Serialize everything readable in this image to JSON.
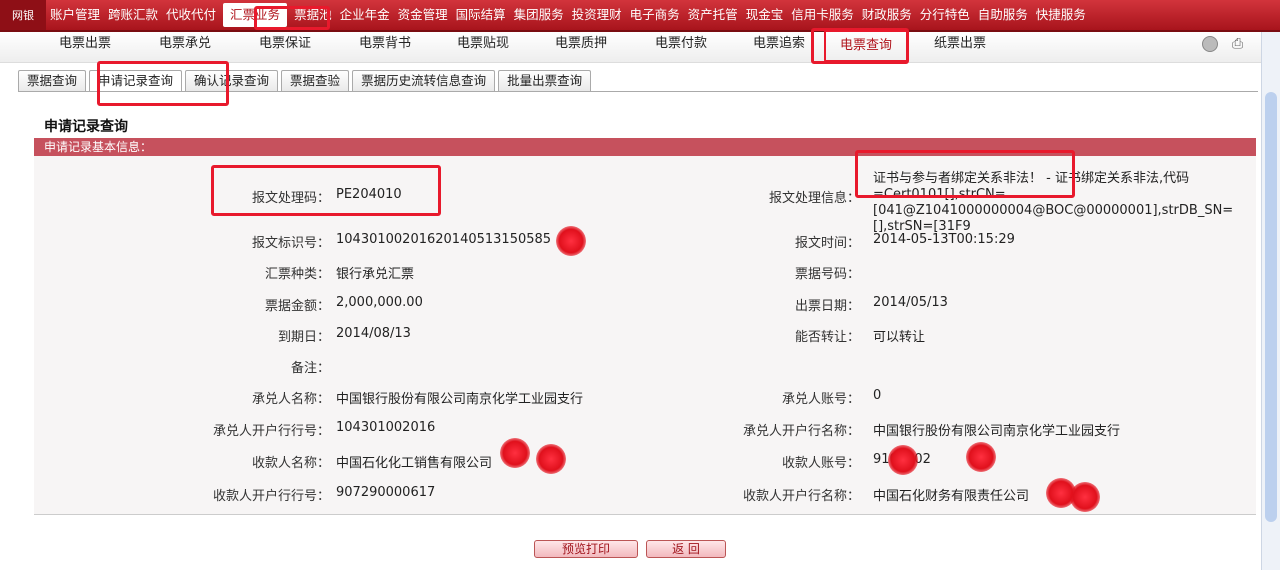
{
  "logo": {
    "text": "网银"
  },
  "top_nav": {
    "items": [
      "账户管理",
      "跨账汇款",
      "代收代付",
      "汇票业务",
      "票据池",
      "企业年金",
      "资金管理",
      "国际结算",
      "集团服务",
      "投资理财",
      "电子商务",
      "资产托管",
      "现金宝",
      "信用卡服务",
      "财政服务",
      "分行特色",
      "自助服务",
      "快捷服务"
    ],
    "active_index": 3
  },
  "sub_nav": {
    "items": [
      "电票出票",
      "电票承兑",
      "电票保证",
      "电票背书",
      "电票贴现",
      "电票质押",
      "电票付款",
      "电票追索",
      "电票查询",
      "纸票出票"
    ],
    "active_index": 8
  },
  "tabs": {
    "items": [
      "票据查询",
      "申请记录查询",
      "确认记录查询",
      "票据查验",
      "票据历史流转信息查询",
      "批量出票查询"
    ],
    "active_index": 1
  },
  "section": {
    "title": "申请记录查询",
    "bar": "申请记录基本信息："
  },
  "fields": {
    "proc_code": {
      "label": "报文处理码：",
      "value": "PE204010"
    },
    "proc_msg": {
      "label": "报文处理信息：",
      "value": "证书与参与者绑定关系非法！ - 证书绑定关系非法,代码=Cert0101[],strCN=[041@Z1041000000004@BOC@00000001],strDB_SN=[],strSN=[31F9"
    },
    "msg_id": {
      "label": "报文标识号：",
      "value": "10430100201620140513150585"
    },
    "msg_time": {
      "label": "报文时间：",
      "value": "2014-05-13T00:15:29"
    },
    "bill_type": {
      "label": "汇票种类：",
      "value": "银行承兑汇票"
    },
    "bill_no": {
      "label": "票据号码：",
      "value": ""
    },
    "amount": {
      "label": "票据金额：",
      "value": "2,000,000.00"
    },
    "issue_date": {
      "label": "出票日期：",
      "value": "2014/05/13"
    },
    "due_date": {
      "label": "到期日：",
      "value": "2014/08/13"
    },
    "transferable": {
      "label": "能否转让：",
      "value": "可以转让"
    },
    "remark": {
      "label": "备注：",
      "value": ""
    },
    "acceptor_name": {
      "label": "承兑人名称：",
      "value": "中国银行股份有限公司南京化学工业园支行"
    },
    "acceptor_acct": {
      "label": "承兑人账号：",
      "value": "0"
    },
    "acceptor_bank_no": {
      "label": "承兑人开户行行号：",
      "value": "104301002016"
    },
    "acceptor_bank_name": {
      "label": "承兑人开户行名称：",
      "value": "中国银行股份有限公司南京化学工业园支行"
    },
    "payee_name": {
      "label": "收款人名称：",
      "value": "中国石化化工销售有限公司"
    },
    "payee_acct": {
      "label": "收款人账号：",
      "value": "9100002"
    },
    "payee_bank_no": {
      "label": "收款人开户行行号：",
      "value": "907290000617"
    },
    "payee_bank_name": {
      "label": "收款人开户行名称：",
      "value": "中国石化财务有限责任公司"
    }
  },
  "buttons": {
    "print": "预览打印",
    "back": "返 回"
  },
  "colors": {
    "brand": "#b0141c",
    "highlight": "#e8192c",
    "section_bar": "#c6515d"
  }
}
